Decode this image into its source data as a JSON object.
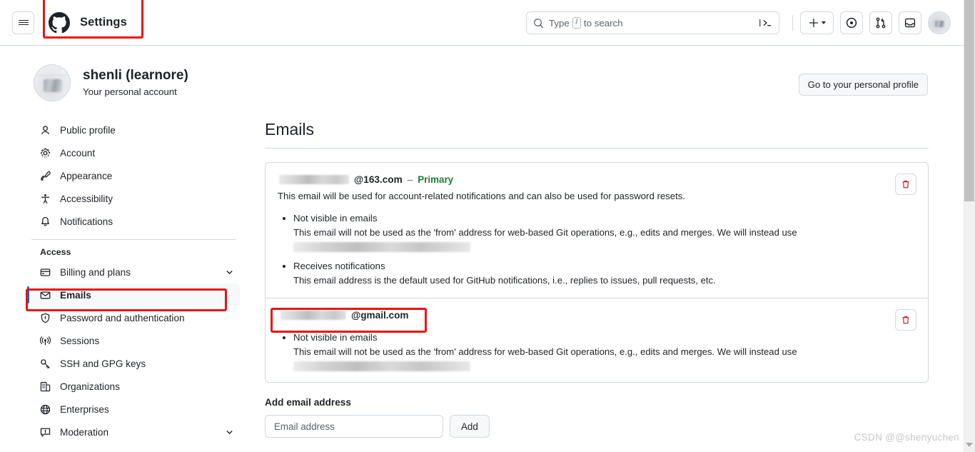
{
  "header": {
    "menu_icon": "hamburger-icon",
    "logo_icon": "github-mark-icon",
    "title": "Settings",
    "search": {
      "icon": "search-icon",
      "placeholder_before": "Type",
      "placeholder_key": "/",
      "placeholder_after": "to search",
      "terminal_icon": "command-palette-icon"
    },
    "actions": [
      {
        "name": "create-new-button",
        "icon": "plus-icon"
      },
      {
        "name": "issues-button",
        "icon": "issue-opened-icon"
      },
      {
        "name": "pull-requests-button",
        "icon": "git-pull-request-icon"
      },
      {
        "name": "notifications-button",
        "icon": "inbox-icon"
      },
      {
        "name": "user-avatar-button",
        "icon": "avatar-icon"
      }
    ]
  },
  "account": {
    "name": "shenli (learnore)",
    "subtitle": "Your personal account",
    "profile_button": "Go to your personal profile"
  },
  "sidebar": {
    "primary_items": [
      {
        "label": "Public profile",
        "icon": "person-icon"
      },
      {
        "label": "Account",
        "icon": "gear-icon"
      },
      {
        "label": "Appearance",
        "icon": "paintbrush-icon"
      },
      {
        "label": "Accessibility",
        "icon": "accessibility-icon"
      },
      {
        "label": "Notifications",
        "icon": "bell-icon"
      }
    ],
    "group_title": "Access",
    "access_items": [
      {
        "label": "Billing and plans",
        "icon": "credit-card-icon",
        "chevron": true,
        "selected": false
      },
      {
        "label": "Emails",
        "icon": "mail-icon",
        "chevron": false,
        "selected": true
      },
      {
        "label": "Password and authentication",
        "icon": "shield-lock-icon",
        "chevron": false,
        "selected": false
      },
      {
        "label": "Sessions",
        "icon": "broadcast-icon",
        "chevron": false,
        "selected": false
      },
      {
        "label": "SSH and GPG keys",
        "icon": "key-icon",
        "chevron": false,
        "selected": false
      },
      {
        "label": "Organizations",
        "icon": "organization-icon",
        "chevron": false,
        "selected": false
      },
      {
        "label": "Enterprises",
        "icon": "globe-icon",
        "chevron": false,
        "selected": false
      },
      {
        "label": "Moderation",
        "icon": "report-icon",
        "chevron": true,
        "selected": false
      }
    ]
  },
  "main": {
    "title": "Emails",
    "emails": [
      {
        "address_visible": "@163.com",
        "address_redacted": true,
        "separator": "–",
        "badge": "Primary",
        "description": "This email will be used for account-related notifications and can also be used for password resets.",
        "delete_icon": "trash-icon",
        "bullets": [
          {
            "title": "Not visible in emails",
            "description": "This email will not be used as the 'from' address for web-based Git operations, e.g., edits and merges. We will instead use",
            "redacted_followup": true
          },
          {
            "title": "Receives notifications",
            "description": "This email address is the default used for GitHub notifications, i.e., replies to issues, pull requests, etc.",
            "redacted_followup": false
          }
        ]
      },
      {
        "address_visible": "@gmail.com",
        "address_redacted": true,
        "separator": "",
        "badge": "",
        "description": "",
        "delete_icon": "trash-icon",
        "bullets": [
          {
            "title": "Not visible in emails",
            "description": "This email will not be used as the 'from' address for web-based Git operations, e.g., edits and merges. We will instead use",
            "redacted_followup": true
          }
        ]
      }
    ],
    "add_email": {
      "title": "Add email address",
      "input_placeholder": "Email address",
      "input_value": "",
      "button": "Add"
    }
  },
  "watermark": "CSDN @@shenyuchen",
  "colors": {
    "accent": "#0969da",
    "annotation": "#ee1111",
    "primary_badge": "#1a7f37",
    "danger": "#cf222e",
    "border": "#d1d9e0",
    "surface": "#f6f8fa"
  }
}
